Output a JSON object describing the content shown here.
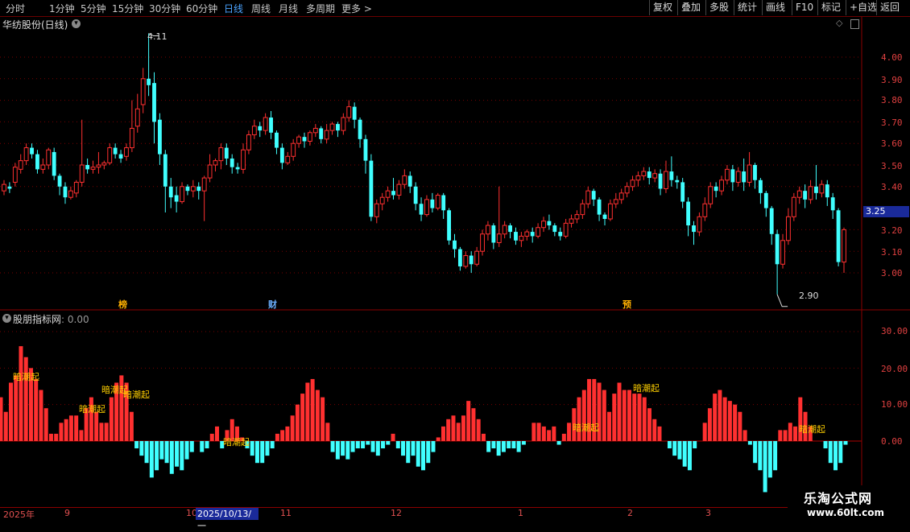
{
  "toolbar": {
    "periods": [
      "分时",
      "1分钟",
      "5分钟",
      "15分钟",
      "30分钟",
      "60分钟",
      "日线",
      "周线",
      "月线",
      "多周期",
      "更多 >"
    ],
    "active_period": "日线",
    "tools": [
      "复权",
      "叠加",
      "多股",
      "统计",
      "画线",
      "F10",
      "标记",
      "+自选",
      "返回"
    ]
  },
  "stock": {
    "title": "华纺股份(日线)"
  },
  "price_axis": [
    "4.00",
    "3.90",
    "3.80",
    "3.70",
    "3.60",
    "3.50",
    "3.40",
    "3.20",
    "3.10",
    "3.00"
  ],
  "current_price_tag": "3.25",
  "high_label": "4.11",
  "low_label": "2.90",
  "event_marks": [
    {
      "text": "榜",
      "color": "#ffb000"
    },
    {
      "text": "财",
      "color": "#6bb0ff"
    },
    {
      "text": "预",
      "color": "#ffb000"
    }
  ],
  "indicator": {
    "name": "股朋指标网",
    "value": ": 0.00",
    "axis": [
      "30.00",
      "20.00",
      "10.00",
      "0.00"
    ]
  },
  "signals": [
    "暗潮起",
    "暗潮起",
    "暗潮起",
    "暗潮起",
    "暗潮起",
    "暗潮起",
    "暗潮起",
    "暗潮起"
  ],
  "dates": [
    "2025年",
    "9",
    "10",
    "11",
    "12",
    "1",
    "2",
    "3"
  ],
  "current_date": "2025/10/13/一",
  "watermark": {
    "line1": "乐淘公式网",
    "line2": "www.60lt.com"
  },
  "colors": {
    "up": "#ff3030",
    "down": "#40ffff",
    "signal": "#ffd000",
    "grid": "#7a0000"
  },
  "chart_data": {
    "type": "candlestick",
    "candles": [
      [
        3.38,
        3.41,
        3.36,
        3.43
      ],
      [
        3.4,
        3.39,
        3.37,
        3.42
      ],
      [
        3.42,
        3.49,
        3.4,
        3.51
      ],
      [
        3.48,
        3.52,
        3.46,
        3.55
      ],
      [
        3.52,
        3.58,
        3.5,
        3.6
      ],
      [
        3.58,
        3.55,
        3.53,
        3.6
      ],
      [
        3.55,
        3.48,
        3.46,
        3.57
      ],
      [
        3.48,
        3.5,
        3.46,
        3.53
      ],
      [
        3.5,
        3.57,
        3.48,
        3.58
      ],
      [
        3.56,
        3.45,
        3.43,
        3.58
      ],
      [
        3.45,
        3.4,
        3.36,
        3.46
      ],
      [
        3.4,
        3.35,
        3.32,
        3.42
      ],
      [
        3.35,
        3.38,
        3.34,
        3.4
      ],
      [
        3.37,
        3.42,
        3.35,
        3.43
      ],
      [
        3.42,
        3.5,
        3.4,
        3.71
      ],
      [
        3.5,
        3.48,
        3.46,
        3.53
      ],
      [
        3.48,
        3.49,
        3.46,
        3.52
      ],
      [
        3.49,
        3.5,
        3.46,
        3.56
      ],
      [
        3.5,
        3.51,
        3.48,
        3.52
      ],
      [
        3.51,
        3.58,
        3.5,
        3.6
      ],
      [
        3.58,
        3.55,
        3.53,
        3.6
      ],
      [
        3.55,
        3.53,
        3.51,
        3.57
      ],
      [
        3.54,
        3.58,
        3.52,
        3.6
      ],
      [
        3.58,
        3.67,
        3.56,
        3.8
      ],
      [
        3.68,
        3.76,
        3.65,
        3.83
      ],
      [
        3.78,
        3.9,
        3.74,
        3.95
      ],
      [
        3.9,
        3.87,
        3.82,
        4.11
      ],
      [
        3.88,
        3.7,
        3.6,
        3.93
      ],
      [
        3.71,
        3.55,
        3.5,
        3.74
      ],
      [
        3.55,
        3.4,
        3.28,
        3.57
      ],
      [
        3.4,
        3.35,
        3.3,
        3.44
      ],
      [
        3.36,
        3.33,
        3.28,
        3.4
      ],
      [
        3.33,
        3.4,
        3.32,
        3.42
      ],
      [
        3.4,
        3.38,
        3.36,
        3.41
      ],
      [
        3.38,
        3.4,
        3.35,
        3.43
      ],
      [
        3.4,
        3.38,
        3.34,
        3.42
      ],
      [
        3.38,
        3.44,
        3.24,
        3.45
      ],
      [
        3.44,
        3.5,
        3.42,
        3.55
      ],
      [
        3.5,
        3.52,
        3.47,
        3.53
      ],
      [
        3.52,
        3.58,
        3.48,
        3.6
      ],
      [
        3.58,
        3.53,
        3.5,
        3.6
      ],
      [
        3.53,
        3.49,
        3.46,
        3.55
      ],
      [
        3.49,
        3.48,
        3.46,
        3.51
      ],
      [
        3.48,
        3.57,
        3.46,
        3.6
      ],
      [
        3.57,
        3.64,
        3.55,
        3.66
      ],
      [
        3.64,
        3.68,
        3.62,
        3.71
      ],
      [
        3.68,
        3.66,
        3.63,
        3.7
      ],
      [
        3.66,
        3.72,
        3.64,
        3.74
      ],
      [
        3.72,
        3.65,
        3.62,
        3.75
      ],
      [
        3.65,
        3.58,
        3.55,
        3.66
      ],
      [
        3.58,
        3.51,
        3.48,
        3.6
      ],
      [
        3.51,
        3.54,
        3.5,
        3.56
      ],
      [
        3.54,
        3.6,
        3.52,
        3.62
      ],
      [
        3.6,
        3.63,
        3.58,
        3.64
      ],
      [
        3.63,
        3.61,
        3.58,
        3.65
      ],
      [
        3.61,
        3.65,
        3.59,
        3.66
      ],
      [
        3.65,
        3.67,
        3.63,
        3.69
      ],
      [
        3.67,
        3.62,
        3.6,
        3.68
      ],
      [
        3.62,
        3.66,
        3.6,
        3.69
      ],
      [
        3.66,
        3.69,
        3.64,
        3.7
      ],
      [
        3.69,
        3.66,
        3.63,
        3.7
      ],
      [
        3.66,
        3.72,
        3.64,
        3.74
      ],
      [
        3.72,
        3.77,
        3.7,
        3.8
      ],
      [
        3.77,
        3.71,
        3.67,
        3.79
      ],
      [
        3.71,
        3.62,
        3.58,
        3.72
      ],
      [
        3.62,
        3.52,
        3.46,
        3.64
      ],
      [
        3.52,
        3.26,
        3.24,
        3.55
      ],
      [
        3.26,
        3.32,
        3.23,
        3.34
      ],
      [
        3.32,
        3.35,
        3.29,
        3.37
      ],
      [
        3.35,
        3.38,
        3.33,
        3.4
      ],
      [
        3.38,
        3.36,
        3.34,
        3.44
      ],
      [
        3.36,
        3.41,
        3.34,
        3.43
      ],
      [
        3.41,
        3.45,
        3.39,
        3.48
      ],
      [
        3.45,
        3.4,
        3.37,
        3.47
      ],
      [
        3.4,
        3.32,
        3.29,
        3.42
      ],
      [
        3.32,
        3.27,
        3.24,
        3.35
      ],
      [
        3.27,
        3.34,
        3.26,
        3.36
      ],
      [
        3.34,
        3.3,
        3.28,
        3.37
      ],
      [
        3.3,
        3.36,
        3.29,
        3.37
      ],
      [
        3.36,
        3.29,
        3.25,
        3.37
      ],
      [
        3.29,
        3.15,
        3.13,
        3.3
      ],
      [
        3.15,
        3.11,
        3.07,
        3.18
      ],
      [
        3.11,
        3.03,
        3.01,
        3.12
      ],
      [
        3.03,
        3.08,
        3.02,
        3.1
      ],
      [
        3.08,
        3.04,
        3.0,
        3.1
      ],
      [
        3.04,
        3.1,
        3.03,
        3.12
      ],
      [
        3.1,
        3.18,
        3.08,
        3.2
      ],
      [
        3.18,
        3.22,
        3.15,
        3.24
      ],
      [
        3.22,
        3.14,
        3.11,
        3.23
      ],
      [
        3.14,
        3.18,
        3.12,
        3.4
      ],
      [
        3.18,
        3.22,
        3.16,
        3.24
      ],
      [
        3.22,
        3.19,
        3.16,
        3.23
      ],
      [
        3.19,
        3.15,
        3.13,
        3.21
      ],
      [
        3.15,
        3.17,
        3.12,
        3.19
      ],
      [
        3.17,
        3.19,
        3.15,
        3.2
      ],
      [
        3.19,
        3.17,
        3.14,
        3.21
      ],
      [
        3.17,
        3.21,
        3.16,
        3.23
      ],
      [
        3.21,
        3.24,
        3.19,
        3.26
      ],
      [
        3.24,
        3.22,
        3.2,
        3.27
      ],
      [
        3.22,
        3.19,
        3.17,
        3.23
      ],
      [
        3.19,
        3.17,
        3.15,
        3.21
      ],
      [
        3.17,
        3.23,
        3.16,
        3.25
      ],
      [
        3.23,
        3.25,
        3.21,
        3.27
      ],
      [
        3.25,
        3.27,
        3.23,
        3.29
      ],
      [
        3.27,
        3.32,
        3.25,
        3.34
      ],
      [
        3.32,
        3.38,
        3.3,
        3.4
      ],
      [
        3.38,
        3.34,
        3.31,
        3.39
      ],
      [
        3.34,
        3.27,
        3.24,
        3.35
      ],
      [
        3.27,
        3.25,
        3.22,
        3.28
      ],
      [
        3.25,
        3.32,
        3.24,
        3.34
      ],
      [
        3.32,
        3.34,
        3.3,
        3.37
      ],
      [
        3.34,
        3.37,
        3.32,
        3.39
      ],
      [
        3.37,
        3.4,
        3.35,
        3.42
      ],
      [
        3.4,
        3.43,
        3.38,
        3.45
      ],
      [
        3.43,
        3.45,
        3.4,
        3.47
      ],
      [
        3.45,
        3.47,
        3.43,
        3.49
      ],
      [
        3.47,
        3.44,
        3.41,
        3.49
      ],
      [
        3.44,
        3.46,
        3.42,
        3.48
      ],
      [
        3.46,
        3.39,
        3.36,
        3.48
      ],
      [
        3.39,
        3.47,
        3.37,
        3.52
      ],
      [
        3.47,
        3.43,
        3.4,
        3.54
      ],
      [
        3.43,
        3.42,
        3.39,
        3.45
      ],
      [
        3.42,
        3.33,
        3.3,
        3.44
      ],
      [
        3.33,
        3.22,
        3.17,
        3.35
      ],
      [
        3.22,
        3.19,
        3.13,
        3.24
      ],
      [
        3.19,
        3.26,
        3.17,
        3.28
      ],
      [
        3.26,
        3.32,
        3.24,
        3.35
      ],
      [
        3.32,
        3.4,
        3.3,
        3.42
      ],
      [
        3.4,
        3.38,
        3.35,
        3.42
      ],
      [
        3.38,
        3.43,
        3.36,
        3.45
      ],
      [
        3.43,
        3.48,
        3.41,
        3.5
      ],
      [
        3.48,
        3.42,
        3.38,
        3.5
      ],
      [
        3.42,
        3.47,
        3.4,
        3.49
      ],
      [
        3.47,
        3.42,
        3.38,
        3.53
      ],
      [
        3.42,
        3.5,
        3.4,
        3.56
      ],
      [
        3.5,
        3.43,
        3.39,
        3.51
      ],
      [
        3.43,
        3.37,
        3.32,
        3.44
      ],
      [
        3.37,
        3.3,
        3.26,
        3.38
      ],
      [
        3.3,
        3.18,
        3.13,
        3.31
      ],
      [
        3.18,
        3.04,
        2.9,
        3.2
      ],
      [
        3.04,
        3.15,
        3.02,
        3.18
      ],
      [
        3.15,
        3.26,
        3.13,
        3.3
      ],
      [
        3.26,
        3.35,
        3.24,
        3.37
      ],
      [
        3.35,
        3.38,
        3.32,
        3.4
      ],
      [
        3.38,
        3.34,
        3.3,
        3.41
      ],
      [
        3.34,
        3.4,
        3.32,
        3.43
      ],
      [
        3.4,
        3.37,
        3.34,
        3.5
      ],
      [
        3.37,
        3.41,
        3.35,
        3.43
      ],
      [
        3.41,
        3.35,
        3.31,
        3.43
      ],
      [
        3.35,
        3.29,
        3.25,
        3.37
      ],
      [
        3.29,
        3.05,
        3.03,
        3.3
      ],
      [
        3.05,
        3.2,
        3.0,
        3.21
      ]
    ],
    "candle_fields": [
      "open",
      "close",
      "low",
      "high"
    ],
    "indicator_bars": [
      12,
      8,
      16,
      18,
      26,
      23,
      20,
      17,
      14,
      9,
      2,
      2,
      5,
      6,
      7,
      7,
      3,
      9,
      12,
      8,
      5,
      5,
      12,
      16,
      18,
      16,
      8,
      -2,
      -4,
      -6,
      -10,
      -8,
      -5,
      -6,
      -9,
      -7,
      -8,
      -5,
      -3,
      0,
      -3,
      -2,
      2,
      4,
      -2,
      3,
      6,
      4,
      1,
      -2,
      -4,
      -6,
      -6,
      -4,
      -2,
      2,
      3,
      4,
      7,
      10,
      13,
      16,
      17,
      14,
      12,
      5,
      -3,
      -5,
      -4,
      -5,
      -3,
      -2,
      -2,
      -1,
      -3,
      -4,
      -2,
      -1,
      2,
      -2,
      -4,
      -6,
      -4,
      -7,
      -8,
      -6,
      -3,
      1,
      4,
      6,
      7,
      5,
      7,
      11,
      9,
      6,
      2,
      -3,
      -2,
      -4,
      -3,
      -2,
      -2,
      -3,
      -1,
      0,
      5,
      5,
      4,
      3,
      4,
      -1,
      2,
      5,
      9,
      12,
      14,
      17,
      17,
      16,
      14,
      8,
      13,
      16,
      14,
      14,
      13,
      13,
      12,
      9,
      6,
      4,
      0,
      -2,
      -4,
      -5,
      -7,
      -8,
      -2,
      0,
      5,
      9,
      13,
      14,
      12,
      11,
      10,
      8,
      3,
      -1,
      -6,
      -8,
      -14,
      -10,
      -8,
      3,
      3,
      5,
      4,
      12,
      8,
      4,
      0,
      0,
      -2,
      -6,
      -8,
      -6,
      -1
    ]
  }
}
